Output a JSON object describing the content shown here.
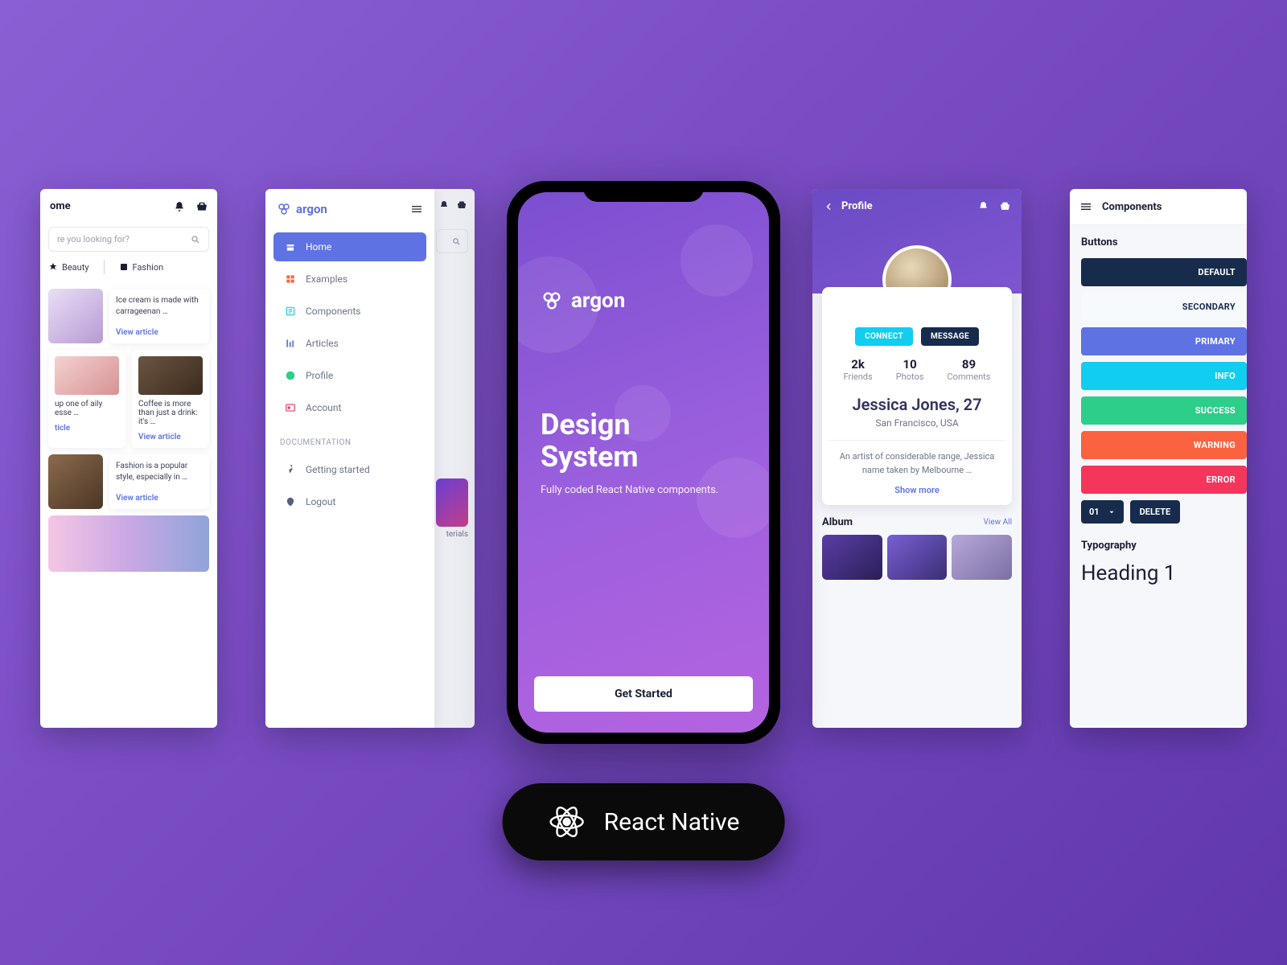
{
  "screen1": {
    "title": "ome",
    "search_placeholder": "re you looking for?",
    "cat_beauty": "Beauty",
    "cat_fashion": "Fashion",
    "card1_text": "Ice cream is made with carrageenan …",
    "card2a_text": "up one of aily esse …",
    "card2b_text": "Coffee is more than just a drink: it's …",
    "card3_text": "Fashion is a popular style, especially in …",
    "view_article": "View article",
    "view_article_short": "ticle"
  },
  "screen2": {
    "brand": "argon",
    "items": [
      {
        "label": "Home",
        "active": true,
        "color": "#fff"
      },
      {
        "label": "Examples",
        "color": "#fb6340"
      },
      {
        "label": "Components",
        "color": "#11cdef"
      },
      {
        "label": "Articles",
        "color": "#5e72e4"
      },
      {
        "label": "Profile",
        "color": "#2dce89"
      },
      {
        "label": "Account",
        "color": "#f5365c"
      }
    ],
    "section": "DOCUMENTATION",
    "doc_items": [
      {
        "label": "Getting started"
      },
      {
        "label": "Logout"
      }
    ],
    "peek_label": "terials"
  },
  "screen3": {
    "brand": "argon",
    "heading": "Design System",
    "sub": "Fully coded React Native components.",
    "cta": "Get Started"
  },
  "screen4": {
    "title": "Profile",
    "connect": "CONNECT",
    "message": "MESSAGE",
    "stats": [
      {
        "n": "2k",
        "l": "Friends"
      },
      {
        "n": "10",
        "l": "Photos"
      },
      {
        "n": "89",
        "l": "Comments"
      }
    ],
    "name": "Jessica Jones, 27",
    "location": "San Francisco, USA",
    "bio": "An artist of considerable range, Jessica name taken by Melbourne …",
    "more": "Show more",
    "album": "Album",
    "view_all": "View All"
  },
  "screen5": {
    "title": "Components",
    "section_buttons": "Buttons",
    "buttons": [
      {
        "label": "DEFAULT",
        "bg": "#172b4d"
      },
      {
        "label": "SECONDARY",
        "bg": "#f7fafc",
        "fg": "#172b4d"
      },
      {
        "label": "PRIMARY",
        "bg": "#5e72e4"
      },
      {
        "label": "INFO",
        "bg": "#11cdef"
      },
      {
        "label": "SUCCESS",
        "bg": "#2dce89"
      },
      {
        "label": "WARNING",
        "bg": "#fb6340"
      },
      {
        "label": "ERROR",
        "bg": "#f5365c"
      }
    ],
    "select_value": "01",
    "delete": "DELETE",
    "section_typo": "Typography",
    "heading1": "Heading 1"
  },
  "badge": {
    "label": "React Native"
  }
}
